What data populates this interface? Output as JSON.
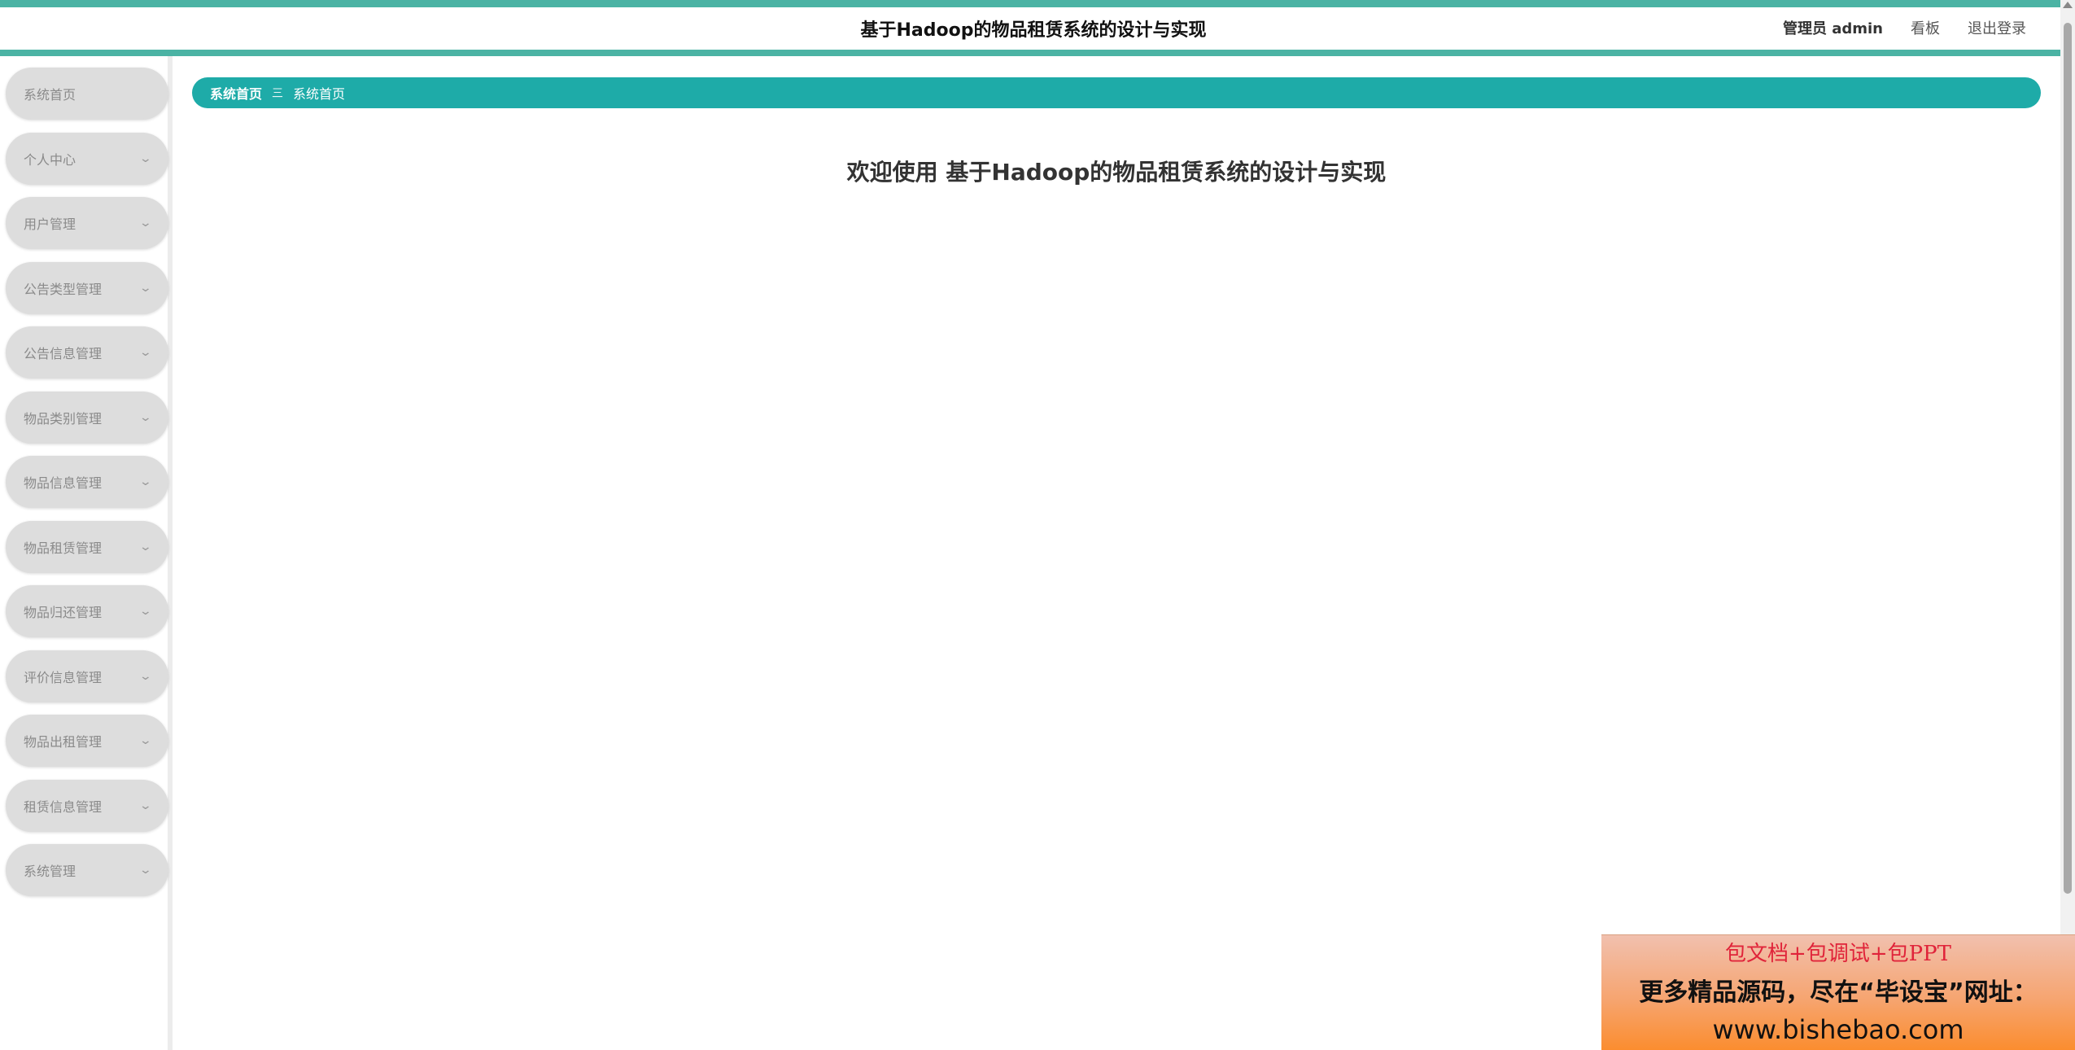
{
  "header": {
    "title": "基于Hadoop的物品租赁系统的设计与实现",
    "admin_label": "管理员 admin",
    "dashboard_link": "看板",
    "logout_link": "退出登录"
  },
  "sidebar": {
    "items": [
      {
        "label": "系统首页",
        "expandable": false
      },
      {
        "label": "个人中心",
        "expandable": true
      },
      {
        "label": "用户管理",
        "expandable": true
      },
      {
        "label": "公告类型管理",
        "expandable": true
      },
      {
        "label": "公告信息管理",
        "expandable": true
      },
      {
        "label": "物品类别管理",
        "expandable": true
      },
      {
        "label": "物品信息管理",
        "expandable": true
      },
      {
        "label": "物品租赁管理",
        "expandable": true
      },
      {
        "label": "物品归还管理",
        "expandable": true
      },
      {
        "label": "评价信息管理",
        "expandable": true
      },
      {
        "label": "物品出租管理",
        "expandable": true
      },
      {
        "label": "租赁信息管理",
        "expandable": true
      },
      {
        "label": "系统管理",
        "expandable": true
      }
    ]
  },
  "breadcrumb": {
    "root": "系统首页",
    "separator": "三",
    "current": "系统首页"
  },
  "main": {
    "welcome": "欢迎使用 基于Hadoop的物品租赁系统的设计与实现"
  },
  "ad": {
    "line1": "包文档+包调试+包PPT",
    "line2": "更多精品源码，尽在“毕设宝”网址：",
    "line3": "www.bishebao.com"
  },
  "colors": {
    "accent": "#1eaba8",
    "header_stripe": "#4bb3a4",
    "menu_bg": "#dddddd"
  },
  "icons": {
    "menu_chevron": "chevron-down-icon",
    "breadcrumb_separator": "menu-lines-icon"
  }
}
